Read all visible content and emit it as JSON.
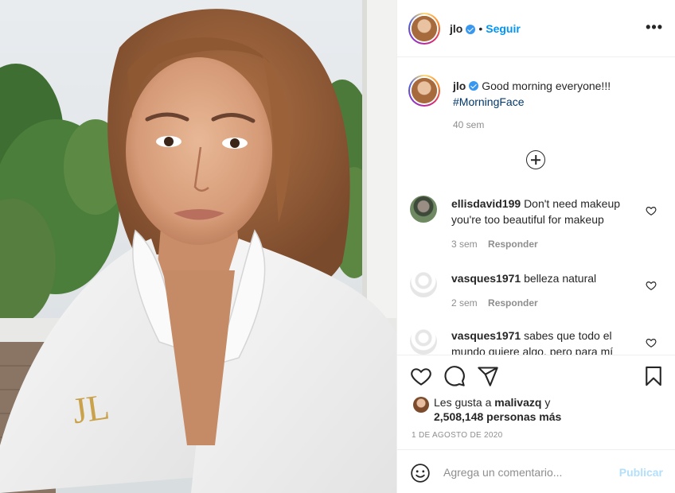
{
  "photo": {
    "embroidery": "JL"
  },
  "header": {
    "username": "jlo",
    "separator": "•",
    "follow_label": "Seguir",
    "more_icon": "more-horizontal-icon"
  },
  "caption": {
    "username": "jlo",
    "text": "Good morning everyone!!!",
    "hashtag": "#MorningFace",
    "time": "40 sem"
  },
  "load_more_icon": "plus-circle-icon",
  "comments": [
    {
      "username": "ellisdavid199",
      "text": "Don't need makeup you're too beautiful for makeup",
      "time": "3 sem",
      "reply_label": "Responder"
    },
    {
      "username": "vasques1971",
      "text": "belleza natural",
      "time": "2 sem",
      "reply_label": "Responder"
    },
    {
      "username": "vasques1971",
      "text": "sabes que todo el mundo quiere algo, pero para mí",
      "time": "",
      "reply_label": ""
    }
  ],
  "likes": {
    "prefix": "Les gusta a",
    "user": "malivazq",
    "connector": "y",
    "count": "2,508,148 personas más"
  },
  "date": "1 DE AGOSTO DE 2020",
  "add_comment": {
    "placeholder": "Agrega un comentario...",
    "post_label": "Publicar"
  },
  "colors": {
    "link": "#0095f6",
    "verified": "#3897f0",
    "muted": "#8e8e8e",
    "post_disabled": "#b2dffc"
  }
}
